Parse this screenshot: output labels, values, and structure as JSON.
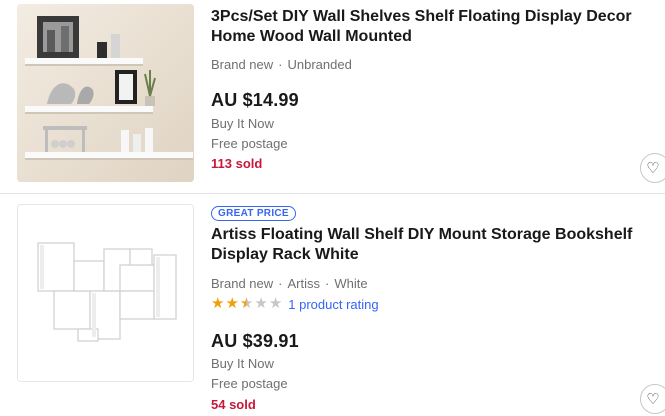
{
  "results": [
    {
      "title": "3Pcs/Set DIY Wall Shelves Shelf Floating Display Decor Home Wood Wall Mounted",
      "condition": "Brand new",
      "brand": "Unbranded",
      "price": "AU $14.99",
      "buying_format": "Buy It Now",
      "shipping": "Free postage",
      "sold": "113 sold",
      "image_icon": "wall-shelves-photo",
      "watch_icon": "heart-icon"
    },
    {
      "badge": "GREAT PRICE",
      "title": "Artiss Floating Wall Shelf DIY Mount Storage Bookshelf Display Rack White",
      "condition": "Brand new",
      "brand": "Artiss",
      "color": "White",
      "rating_stars": 2.5,
      "rating_max": 5,
      "rating_count": "1 product rating",
      "price": "AU $39.91",
      "buying_format": "Buy It Now",
      "shipping": "Free postage",
      "sold": "54 sold",
      "image_icon": "bookshelf-photo",
      "watch_icon": "heart-icon"
    }
  ],
  "colors": {
    "sold": "#c7183a",
    "link": "#3665f3",
    "star": "#f0a00a",
    "secondary_text": "#707070"
  }
}
